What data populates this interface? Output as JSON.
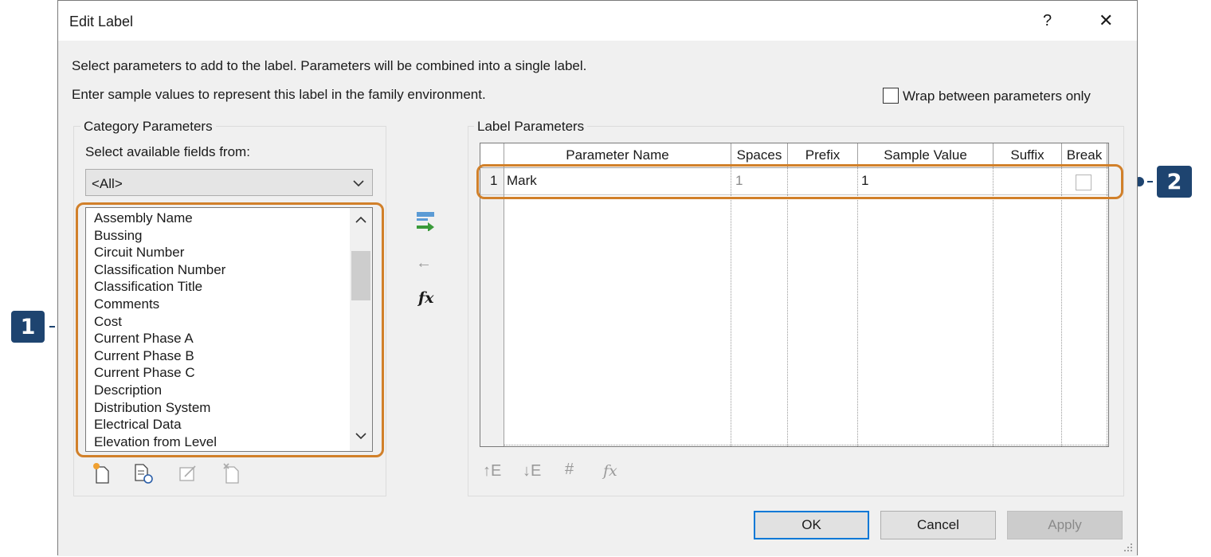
{
  "dialog": {
    "title": "Edit Label",
    "help_glyph": "?",
    "close_glyph": "✕",
    "instruction_1": "Select parameters to add to the label.  Parameters will be combined into a single label.",
    "instruction_2": "Enter sample values to represent this label in the family environment.",
    "wrap_option": {
      "label": "Wrap between parameters only",
      "checked": false
    }
  },
  "category_parameters": {
    "group_label": "Category Parameters",
    "select_fields_label": "Select available fields from:",
    "dropdown_value": "<All>",
    "items": [
      "Assembly Name",
      "Bussing",
      "Circuit Number",
      "Classification Number",
      "Classification Title",
      "Comments",
      "Cost",
      "Current Phase A",
      "Current Phase B",
      "Current Phase C",
      "Description",
      "Distribution System",
      "Electrical Data",
      "Elevation from Level"
    ],
    "toolbar_icons": [
      "new-parameter-icon",
      "edit-parameter-icon",
      "modify-parameter-icon",
      "delete-parameter-icon"
    ]
  },
  "transfer_buttons": {
    "icons": [
      "add-parameter-icon",
      "remove-parameter-icon",
      "formula-icon"
    ],
    "remove_glyph": "←",
    "formula_glyph": "fx"
  },
  "label_parameters": {
    "group_label": "Label Parameters",
    "columns": [
      "Parameter Name",
      "Spaces",
      "Prefix",
      "Sample Value",
      "Suffix",
      "Break"
    ],
    "rows": [
      {
        "num": "1",
        "parameter_name": "Mark",
        "spaces": "1",
        "prefix": "",
        "sample_value": "1",
        "suffix": "",
        "break": false
      }
    ],
    "toolbar_icons": [
      "move-up-icon",
      "move-down-icon",
      "edit-icon",
      "formula-edit-icon"
    ],
    "toolbar_glyphs": {
      "move_up": "↑E",
      "move_down": "↓E",
      "edit": "#",
      "formula": "fx"
    }
  },
  "buttons": {
    "ok": "OK",
    "cancel": "Cancel",
    "apply": "Apply"
  },
  "callouts": [
    {
      "number": "1"
    },
    {
      "number": "2"
    }
  ],
  "colors": {
    "callout": "#1e4470",
    "highlight": "#d1802a",
    "default_button_border": "#0078d7"
  }
}
